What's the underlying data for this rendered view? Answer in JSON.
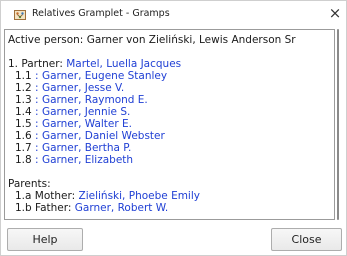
{
  "window": {
    "title": "Relatives Gramplet - Gramps",
    "close_glyph": "×"
  },
  "active_person": {
    "label": "Active person:",
    "name": "Garner von Zieliński, Lewis Anderson Sr"
  },
  "partner": {
    "label": "1. Partner:",
    "name": "Martel, Luella Jacques"
  },
  "children": [
    {
      "index": "1.1",
      "name": "Garner, Eugene Stanley"
    },
    {
      "index": "1.2",
      "name": "Garner, Jesse V."
    },
    {
      "index": "1.3",
      "name": "Garner, Raymond E."
    },
    {
      "index": "1.4",
      "name": "Garner, Jennie S."
    },
    {
      "index": "1.5",
      "name": "Garner, Walter E."
    },
    {
      "index": "1.6",
      "name": "Garner, Daniel Webster"
    },
    {
      "index": "1.7",
      "name": "Garner, Bertha P."
    },
    {
      "index": "1.8",
      "name": "Garner, Elizabeth"
    }
  ],
  "parents": {
    "heading": "Parents:",
    "mother_label": "1.a Mother:",
    "mother_name": "Zieliński, Phoebe Emily",
    "father_label": "1.b Father:",
    "father_name": "Garner, Robert W."
  },
  "buttons": {
    "help": "Help",
    "close": "Close"
  },
  "colors": {
    "link": "#1f3fd4"
  },
  "icons": {
    "app": "gramps-icon",
    "close": "close-icon"
  }
}
